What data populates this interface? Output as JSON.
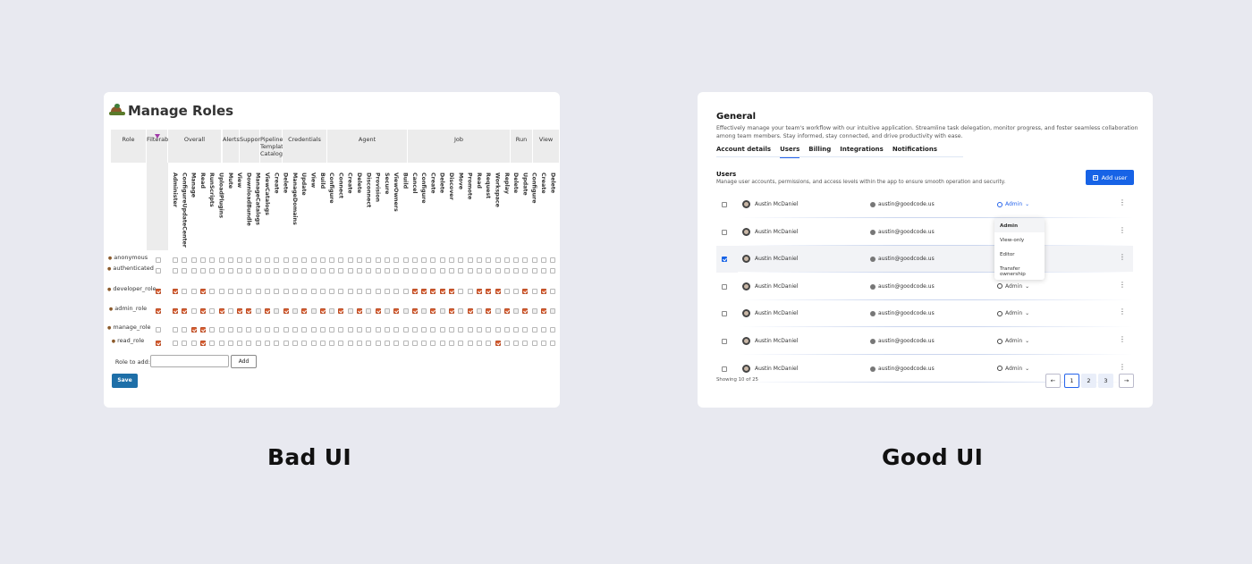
{
  "bad": {
    "title": "Manage Roles",
    "groups": [
      "Role",
      "Filterable",
      "Overall",
      "Alerts",
      "Support",
      "Pipeline\nTemplate\nCatalogs",
      "Credentials",
      "Agent",
      "Job",
      "Run",
      "View"
    ],
    "permissions": [
      "Administer",
      "ConfigureUpdateCenter",
      "Manage",
      "Read",
      "RunScripts",
      "UploadPlugins",
      "Mute",
      "View",
      "DownloadBundle",
      "ManageCatalogs",
      "ViewCatalogs",
      "Create",
      "Delete",
      "ManageDomains",
      "Update",
      "View",
      "Build",
      "Configure",
      "Connect",
      "Create",
      "Delete",
      "Disconnect",
      "Provision",
      "Secure",
      "ViewOwners",
      "Build",
      "Cancel",
      "Configure",
      "Create",
      "Delete",
      "Discover",
      "Move",
      "Promote",
      "Read",
      "Request",
      "Workspace",
      "Replay",
      "Delete",
      "Update",
      "Configure",
      "Create",
      "Delete"
    ],
    "roles": [
      {
        "name": "anonymous"
      },
      {
        "name": "authenticated"
      },
      {
        "name": "developer_role"
      },
      {
        "name": "admin_role"
      },
      {
        "name": "manage_role"
      },
      {
        "name": "read_role"
      }
    ],
    "role_to_add_label": "Role to add:",
    "add_label": "Add",
    "save_label": "Save",
    "caption": "Bad UI"
  },
  "good": {
    "title": "General",
    "description": "Effectively manage your team's workflow with our intuitive application. Streamline task delegation, monitor progress, and foster seamless collaboration among team members. Stay informed, stay connected, and drive productivity with ease.",
    "tabs": [
      "Account details",
      "Users",
      "Billing",
      "Integrations",
      "Notifications"
    ],
    "users_title": "Users",
    "users_desc": "Manage user accounts, permissions, and access levels within the app to ensure smooth operation and security.",
    "add_user_label": "Add user",
    "rows": [
      {
        "name": "Austin McDaniel",
        "email": "austin@goodcode.us",
        "role": "Admin",
        "checked": false
      },
      {
        "name": "Austin McDaniel",
        "email": "austin@goodcode.us",
        "role": "",
        "checked": false
      },
      {
        "name": "Austin McDaniel",
        "email": "austin@goodcode.us",
        "role": "",
        "checked": true
      },
      {
        "name": "Austin McDaniel",
        "email": "austin@goodcode.us",
        "role": "Admin",
        "checked": false
      },
      {
        "name": "Austin McDaniel",
        "email": "austin@goodcode.us",
        "role": "Admin",
        "checked": false
      },
      {
        "name": "Austin McDaniel",
        "email": "austin@goodcode.us",
        "role": "Admin",
        "checked": false
      },
      {
        "name": "Austin McDaniel",
        "email": "austin@goodcode.us",
        "role": "Admin",
        "checked": false
      }
    ],
    "dropdown": [
      "Admin",
      "View-only",
      "Editor",
      "Transfer ownership"
    ],
    "showing": "Showing 10 of 25",
    "pages": [
      "1",
      "2",
      "3"
    ],
    "prev_icon": "arrow-left-icon",
    "next_icon": "arrow-right-icon",
    "caption": "Good UI",
    "accent": "#1763e6"
  }
}
